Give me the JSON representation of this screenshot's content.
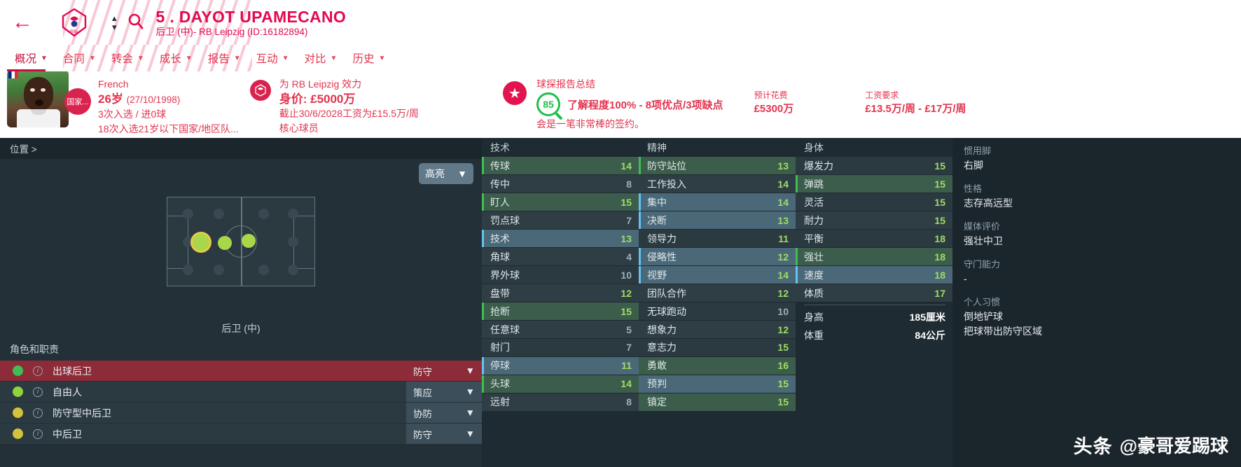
{
  "header": {
    "back_icon": "back-arrow-icon",
    "club_badge_icon": "rb-leipzig-badge-icon",
    "up_icon": "chevron-up-icon",
    "down_icon": "chevron-down-icon",
    "search_icon": "search-icon",
    "player_name": "5 . DAYOT UPAMECANO",
    "player_sub": "后卫 (中)- RB Leipzig (ID:16182894)"
  },
  "nav": {
    "items": [
      {
        "label": "概况",
        "active": true
      },
      {
        "label": "合同",
        "active": false
      },
      {
        "label": "转会",
        "active": false
      },
      {
        "label": "成长",
        "active": false
      },
      {
        "label": "报告",
        "active": false
      },
      {
        "label": "互动",
        "active": false
      },
      {
        "label": "对比",
        "active": false
      },
      {
        "label": "历史",
        "active": false
      }
    ]
  },
  "info": {
    "nation_badge": "国家...",
    "nationality": "French",
    "age_line_main": "26岁",
    "age_line_dob": "(27/10/1998)",
    "caps_line": "3次入选 / 进0球",
    "youth_line": "18次入选21岁以下国家/地区队...",
    "club_line": "为 RB Leipzig 效力",
    "value_label": "身价:",
    "value_amount": "£5000万",
    "contract_line": "截止30/6/2028工资为£15.5万/周",
    "status_line": "核心球员"
  },
  "scout": {
    "star_icon": "star-icon",
    "title": "球探报告总结",
    "rating": "85",
    "summary": "了解程度100% - 8项优点/3项缺点",
    "note": "会是一笔非常棒的签约。",
    "cost_label": "预计花费",
    "cost_value": "£5300万",
    "wage_label": "工资要求",
    "wage_value": "£13.5万/周 - £17万/周"
  },
  "position_panel": {
    "breadcrumb": "位置 >",
    "highlight_button": "高亮",
    "pitch_caption": "后卫 (中)",
    "roles_title": "角色和职责",
    "roles": [
      {
        "name": "出球后卫",
        "duty": "防守",
        "dot": "#3fbf52",
        "selected": true
      },
      {
        "name": "自由人",
        "duty": "策应",
        "dot": "#8fd43a",
        "selected": false
      },
      {
        "name": "防守型中后卫",
        "duty": "协防",
        "dot": "#d4c23a",
        "selected": false
      },
      {
        "name": "中后卫",
        "duty": "防守",
        "dot": "#d4c23a",
        "selected": false
      }
    ]
  },
  "attributes": {
    "technical_head": "技术",
    "mental_head": "精神",
    "physical_head": "身体",
    "technical": [
      {
        "label": "传球",
        "value": "14",
        "hl": "green",
        "bar": "g"
      },
      {
        "label": "传中",
        "value": "8",
        "hl": "none",
        "bar": ""
      },
      {
        "label": "盯人",
        "value": "15",
        "hl": "green",
        "bar": "g"
      },
      {
        "label": "罚点球",
        "value": "7",
        "hl": "none",
        "bar": ""
      },
      {
        "label": "技术",
        "value": "13",
        "hl": "blue",
        "bar": "b"
      },
      {
        "label": "角球",
        "value": "4",
        "hl": "none",
        "bar": ""
      },
      {
        "label": "界外球",
        "value": "10",
        "hl": "none",
        "bar": ""
      },
      {
        "label": "盘带",
        "value": "12",
        "hl": "none",
        "bar": ""
      },
      {
        "label": "抢断",
        "value": "15",
        "hl": "green",
        "bar": "g"
      },
      {
        "label": "任意球",
        "value": "5",
        "hl": "none",
        "bar": ""
      },
      {
        "label": "射门",
        "value": "7",
        "hl": "none",
        "bar": ""
      },
      {
        "label": "停球",
        "value": "11",
        "hl": "blue",
        "bar": "b"
      },
      {
        "label": "头球",
        "value": "14",
        "hl": "green",
        "bar": "g"
      },
      {
        "label": "远射",
        "value": "8",
        "hl": "none",
        "bar": ""
      }
    ],
    "mental": [
      {
        "label": "防守站位",
        "value": "13",
        "hl": "green",
        "bar": "g"
      },
      {
        "label": "工作投入",
        "value": "14",
        "hl": "none",
        "bar": ""
      },
      {
        "label": "集中",
        "value": "14",
        "hl": "blue",
        "bar": "b"
      },
      {
        "label": "决断",
        "value": "13",
        "hl": "blue",
        "bar": "b"
      },
      {
        "label": "领导力",
        "value": "11",
        "hl": "none",
        "bar": ""
      },
      {
        "label": "侵略性",
        "value": "12",
        "hl": "blue",
        "bar": "b"
      },
      {
        "label": "视野",
        "value": "14",
        "hl": "blue",
        "bar": "b"
      },
      {
        "label": "团队合作",
        "value": "12",
        "hl": "none",
        "bar": ""
      },
      {
        "label": "无球跑动",
        "value": "10",
        "hl": "none",
        "bar": ""
      },
      {
        "label": "想象力",
        "value": "12",
        "hl": "none",
        "bar": ""
      },
      {
        "label": "意志力",
        "value": "15",
        "hl": "none",
        "bar": ""
      },
      {
        "label": "勇敢",
        "value": "16",
        "hl": "green",
        "bar": ""
      },
      {
        "label": "预判",
        "value": "15",
        "hl": "blue",
        "bar": ""
      },
      {
        "label": "镇定",
        "value": "15",
        "hl": "green",
        "bar": ""
      }
    ],
    "physical": [
      {
        "label": "爆发力",
        "value": "15",
        "hl": "none",
        "bar": ""
      },
      {
        "label": "弹跳",
        "value": "15",
        "hl": "green",
        "bar": "g"
      },
      {
        "label": "灵活",
        "value": "15",
        "hl": "none",
        "bar": ""
      },
      {
        "label": "耐力",
        "value": "15",
        "hl": "none",
        "bar": ""
      },
      {
        "label": "平衡",
        "value": "18",
        "hl": "none",
        "bar": ""
      },
      {
        "label": "强壮",
        "value": "18",
        "hl": "green",
        "bar": "g"
      },
      {
        "label": "速度",
        "value": "18",
        "hl": "blue",
        "bar": "b"
      },
      {
        "label": "体质",
        "value": "17",
        "hl": "none",
        "bar": ""
      }
    ],
    "physical_meta": [
      {
        "label": "身高",
        "value": "185厘米"
      },
      {
        "label": "体重",
        "value": "84公斤"
      }
    ]
  },
  "sidebar": {
    "foot_label": "惯用脚",
    "foot_value": "右脚",
    "personality_label": "性格",
    "personality_value": "志存高远型",
    "media_label": "媒体评价",
    "media_value": "强壮中卫",
    "gk_label": "守门能力",
    "gk_value": "-",
    "traits_label": "个人习惯",
    "traits": [
      "倒地铲球",
      "把球带出防守区域"
    ]
  },
  "watermark": {
    "logo": "头条",
    "text": "@豪哥爱踢球"
  }
}
